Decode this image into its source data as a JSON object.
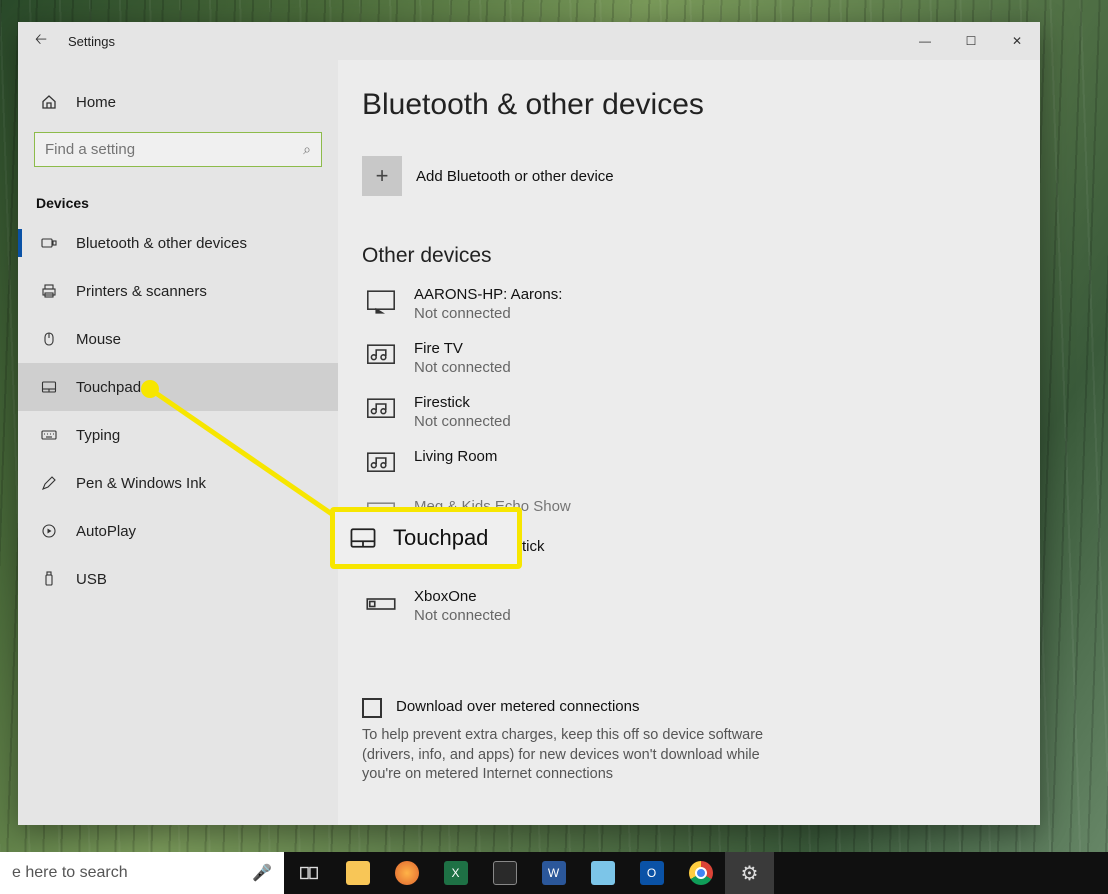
{
  "window": {
    "title": "Settings",
    "back_icon": "back-arrow"
  },
  "sidebar": {
    "home_label": "Home",
    "search_placeholder": "Find a setting",
    "section_label": "Devices",
    "items": [
      {
        "id": "bluetooth",
        "label": "Bluetooth & other devices",
        "active": true,
        "highlight": false
      },
      {
        "id": "printers",
        "label": "Printers & scanners",
        "active": false,
        "highlight": false
      },
      {
        "id": "mouse",
        "label": "Mouse",
        "active": false,
        "highlight": false
      },
      {
        "id": "touchpad",
        "label": "Touchpad",
        "active": false,
        "highlight": true
      },
      {
        "id": "typing",
        "label": "Typing",
        "active": false,
        "highlight": false
      },
      {
        "id": "pen",
        "label": "Pen & Windows Ink",
        "active": false,
        "highlight": false
      },
      {
        "id": "autoplay",
        "label": "AutoPlay",
        "active": false,
        "highlight": false
      },
      {
        "id": "usb",
        "label": "USB",
        "active": false,
        "highlight": false
      }
    ]
  },
  "main": {
    "page_title": "Bluetooth & other devices",
    "add_button_label": "Add Bluetooth or other device",
    "other_devices_header": "Other devices",
    "devices": [
      {
        "name": "AARONS-HP: Aarons:",
        "status": "Not connected"
      },
      {
        "name": "Fire TV",
        "status": "Not connected"
      },
      {
        "name": "Firestick",
        "status": "Not connected"
      },
      {
        "name": "Living Room",
        "status": ""
      },
      {
        "name": "Meg & Kids Echo Show",
        "status": ""
      },
      {
        "name": "Stick",
        "status": ""
      },
      {
        "name": "XboxOne",
        "status": "Not connected"
      }
    ],
    "metered_checkbox_label": "Download over metered connections",
    "metered_checkbox_checked": false,
    "metered_help": "To help prevent extra charges, keep this off so device software (drivers, info, and apps) for new devices won't download while you're on metered Internet connections"
  },
  "annotation": {
    "label": "Touchpad"
  },
  "taskbar": {
    "search_text": "e here to search",
    "items": [
      "task-view",
      "file-explorer",
      "firefox",
      "excel",
      "snagit",
      "word",
      "notes",
      "outlook",
      "chrome",
      "settings"
    ]
  }
}
